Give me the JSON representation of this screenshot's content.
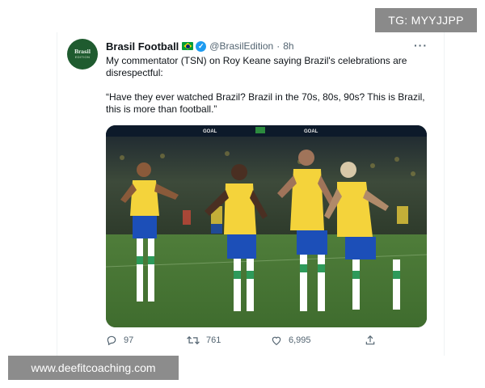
{
  "watermarks": {
    "tg": "TG: MYYJJPP",
    "site": "www.deefitcoaching.com"
  },
  "tweet": {
    "display_name": "Brasil Football",
    "handle": "@BrasilEdition",
    "separator": "·",
    "time": "8h",
    "avatar_text": {
      "line1": "Brasil",
      "line2": "EDITION"
    },
    "text_para1": "My commentator (TSN) on Roy Keane saying Brazil's celebrations are disrespectful:",
    "text_para2": "“Have they ever watched Brazil? Brazil in the 70s, 80s, 90s? This is Brazil, this is more than football.”",
    "more_label": "···",
    "photo_banner": [
      "GOAL",
      "GOAL"
    ],
    "actions": {
      "replies": "97",
      "retweets": "761",
      "likes": "6,995"
    }
  },
  "colors": {
    "verified": "#1d9bf0",
    "muted": "#536471",
    "jersey": "#f4d33b",
    "shorts": "#1c4fb8"
  }
}
